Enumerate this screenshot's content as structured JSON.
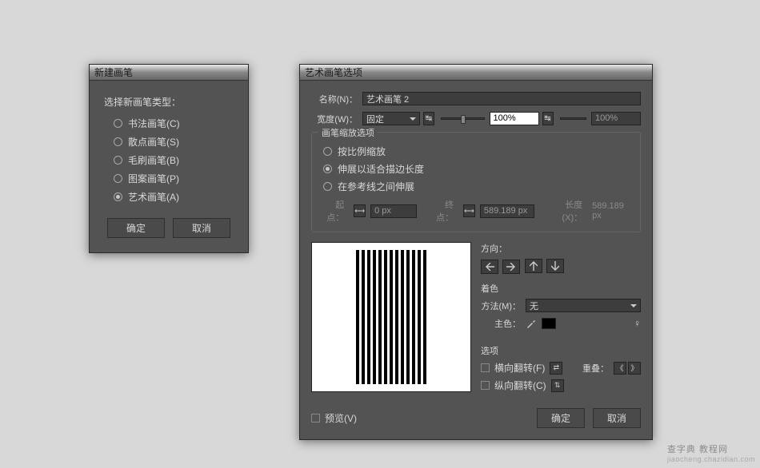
{
  "dialog1": {
    "title": "新建画笔",
    "prompt": "选择新画笔类型：",
    "options": [
      "书法画笔(C)",
      "散点画笔(S)",
      "毛刷画笔(B)",
      "图案画笔(P)",
      "艺术画笔(A)"
    ],
    "selected_index": 4,
    "ok": "确定",
    "cancel": "取消"
  },
  "dialog2": {
    "title": "艺术画笔选项",
    "name_label": "名称(N)：",
    "name_value": "艺术画笔 2",
    "width_label": "宽度(W)：",
    "width_mode": "固定",
    "width_value": "100%",
    "width_value2": "100%",
    "scale": {
      "legend": "画笔缩放选项",
      "options": [
        "按比例缩放",
        "伸展以适合描边长度",
        "在参考线之间伸展"
      ],
      "selected_index": 1,
      "start_label": "起点：",
      "start_value": "0 px",
      "end_label": "终点：",
      "end_value": "589.189 px",
      "length_label": "长度(X)：",
      "length_value": "589.189 px"
    },
    "direction": {
      "label": "方向："
    },
    "colorize": {
      "label": "着色",
      "method_label": "方法(M)：",
      "method_value": "无",
      "key_label": "主色："
    },
    "options": {
      "label": "选项",
      "flipx": "横向翻转(F)",
      "flipy": "纵向翻转(C)",
      "overlap_label": "重叠："
    },
    "preview_label": "预览(V)",
    "ok": "确定",
    "cancel": "取消"
  },
  "watermark": {
    "main": "查字典 教程网",
    "sub": "jiaocheng.chazidian.com"
  }
}
